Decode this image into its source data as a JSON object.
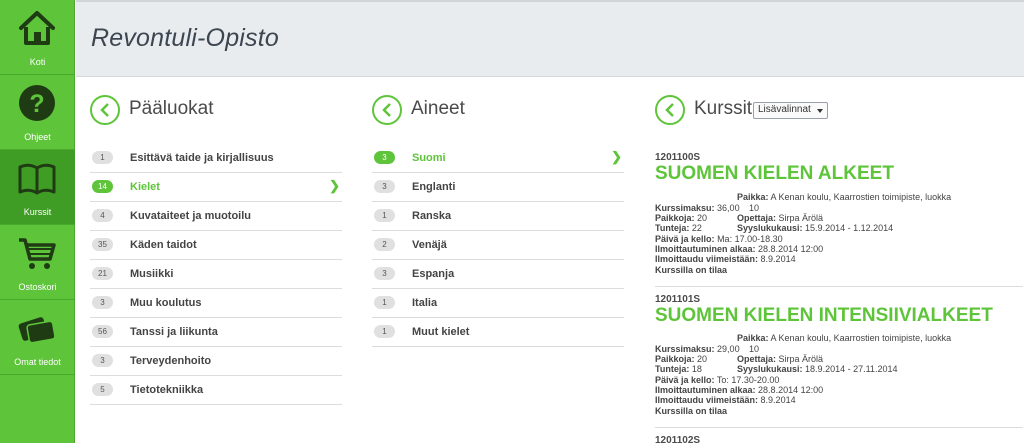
{
  "app": {
    "title": "Revontuli-Opisto"
  },
  "sidebar": {
    "items": [
      {
        "label": "Koti",
        "icon": "home-icon"
      },
      {
        "label": "Ohjeet",
        "icon": "help-icon"
      },
      {
        "label": "Kurssit",
        "icon": "book-icon"
      },
      {
        "label": "Ostoskori",
        "icon": "cart-icon"
      },
      {
        "label": "Omat tiedot",
        "icon": "id-card-icon"
      }
    ],
    "active": "Kurssit"
  },
  "colors": {
    "accent": "#5ec43a",
    "sidebar": "#5ec43a",
    "sidebar_active": "#3f9c25",
    "header_bg": "#e8ecef"
  },
  "main_categories": {
    "title": "Pääluokat",
    "items": [
      {
        "count": "1",
        "label": "Esittävä taide ja kirjallisuus"
      },
      {
        "count": "14",
        "label": "Kielet",
        "selected": true
      },
      {
        "count": "4",
        "label": "Kuvataiteet ja muotoilu"
      },
      {
        "count": "35",
        "label": "Käden taidot"
      },
      {
        "count": "21",
        "label": "Musiikki"
      },
      {
        "count": "3",
        "label": "Muu koulutus"
      },
      {
        "count": "56",
        "label": "Tanssi ja liikunta"
      },
      {
        "count": "3",
        "label": "Terveydenhoito"
      },
      {
        "count": "5",
        "label": "Tietotekniikka"
      }
    ]
  },
  "subjects": {
    "title": "Aineet",
    "items": [
      {
        "count": "3",
        "label": "Suomi",
        "selected": true
      },
      {
        "count": "3",
        "label": "Englanti"
      },
      {
        "count": "1",
        "label": "Ranska"
      },
      {
        "count": "2",
        "label": "Venäjä"
      },
      {
        "count": "3",
        "label": "Espanja"
      },
      {
        "count": "1",
        "label": "Italia"
      },
      {
        "count": "1",
        "label": "Muut kielet"
      }
    ]
  },
  "courses": {
    "title": "Kurssit",
    "options_label": "Lisävalinnat",
    "items": [
      {
        "code": "1201100S",
        "name": "SUOMEN KIELEN ALKEET",
        "fee_label": "Kurssimaksu:",
        "fee": "36,00",
        "places_label": "Paikkoja:",
        "places": "20",
        "hours_label": "Tunteja:",
        "hours": "22",
        "location_label": "Paikka:",
        "location": "A Kenan koulu, Kaarrostien toimipiste, luokka",
        "location_cont": "10",
        "teacher_label": "Opettaja:",
        "teacher": "Sirpa Ärölä",
        "term_label": "Syyslukukausi:",
        "term": "15.9.2014 - 1.12.2014",
        "day_label": "Päivä ja kello:",
        "day": "Ma: 17.00-18.30",
        "reg_start_label": "Ilmoittautuminen alkaa:",
        "reg_start": "28.8.2014 12:00",
        "reg_end_label": "Ilmoittaudu viimeistään:",
        "reg_end": "8.9.2014",
        "status": "Kurssilla on tilaa"
      },
      {
        "code": "1201101S",
        "name": "SUOMEN KIELEN INTENSIIVIALKEET",
        "fee_label": "Kurssimaksu:",
        "fee": "29,00",
        "places_label": "Paikkoja:",
        "places": "20",
        "hours_label": "Tunteja:",
        "hours": "18",
        "location_label": "Paikka:",
        "location": "A Kenan koulu, Kaarrostien toimipiste, luokka",
        "location_cont": "10",
        "teacher_label": "Opettaja:",
        "teacher": "Sirpa Ärölä",
        "term_label": "Syyslukukausi:",
        "term": "18.9.2014 - 27.11.2014",
        "day_label": "Päivä ja kello:",
        "day": "To: 17.30-20.00",
        "reg_start_label": "Ilmoittautuminen alkaa:",
        "reg_start": "28.8.2014 12:00",
        "reg_end_label": "Ilmoittaudu viimeistään:",
        "reg_end": "8.9.2014",
        "status": "Kurssilla on tilaa"
      },
      {
        "code": "1201102S"
      }
    ]
  }
}
